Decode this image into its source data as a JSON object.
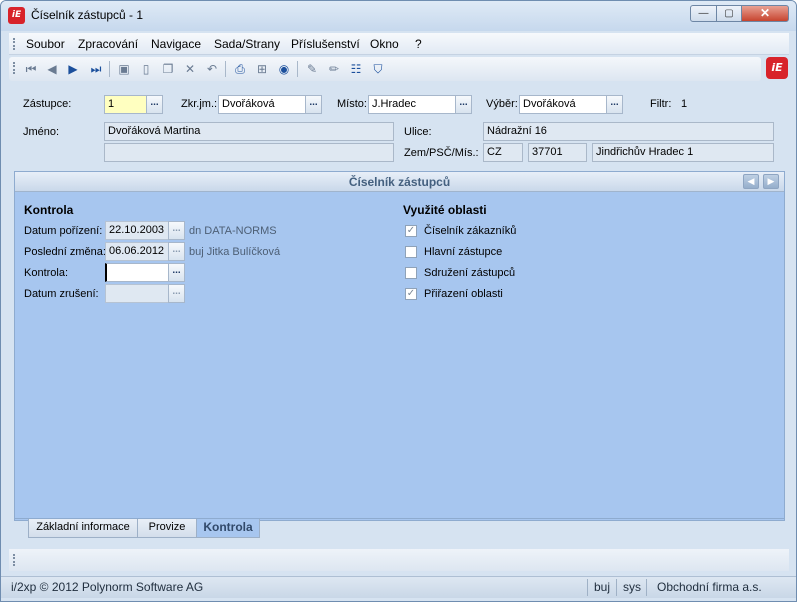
{
  "window": {
    "title": "Číselník zástupců - 1",
    "logo_text": "iE",
    "controls": {
      "minimize": "—",
      "maximize": "▢",
      "close": "✕"
    }
  },
  "menu": [
    "Soubor",
    "Zpracování",
    "Navigace",
    "Sada/Strany",
    "Příslušenství",
    "Okno",
    "?"
  ],
  "toolbar": {
    "icons": [
      "first-record-icon",
      "previous-record-icon",
      "next-record-icon",
      "last-record-icon",
      "save-icon",
      "new-document-icon",
      "copy-icon",
      "delete-icon",
      "undo-icon",
      "print-icon",
      "tree-icon",
      "refresh-icon",
      "edit-icon",
      "pencil-icon",
      "properties-icon",
      "filter-icon"
    ],
    "brand_logo": "iE"
  },
  "header": {
    "zastupce_label": "Zástupce:",
    "zastupce_value": "1",
    "zkrjm_label": "Zkr.jm.:",
    "zkrjm_value": "Dvořáková",
    "misto_label": "Místo:",
    "misto_value": "J.Hradec",
    "vyber_label": "Výběr:",
    "vyber_value": "Dvořáková",
    "filtr_label": "Filtr:",
    "filtr_value": "1",
    "jmeno_label": "Jméno:",
    "jmeno_value": "Dvořáková Martina",
    "jmeno2_value": "",
    "ulice_label": "Ulice:",
    "ulice_value": "Nádražní 16",
    "zem_label": "Zem/PSČ/Mís.:",
    "zem_value": "CZ",
    "psc_value": "37701",
    "mesto_value": "Jindřichův Hradec 1",
    "dots": "..."
  },
  "panel": {
    "title": "Číselník zástupců",
    "nav_prev": "◀",
    "nav_next": "▶",
    "kontrola_section": "Kontrola",
    "datum_porizeni_label": "Datum pořízení:",
    "datum_porizeni_value": "22.10.2003",
    "datum_porizeni_suffix": "dn  DATA-NORMS",
    "posledni_zmena_label": "Poslední změna:",
    "posledni_zmena_value": "06.06.2012",
    "posledni_zmena_suffix": "buj  Jitka Bulíčková",
    "kontrola_label": "Kontrola:",
    "kontrola_value": "",
    "datum_zruseni_label": "Datum zrušení:",
    "datum_zruseni_value": "",
    "oblasti_section": "Využité oblasti",
    "checkboxes": [
      {
        "label": "Číselník zákazníků",
        "checked": true
      },
      {
        "label": "Hlavní zástupce",
        "checked": false
      },
      {
        "label": "Sdružení zástupců",
        "checked": false
      },
      {
        "label": "Přiřazení oblasti",
        "checked": true
      }
    ]
  },
  "tabs": [
    "Základní informace",
    "Provize",
    "Kontrola"
  ],
  "active_tab": "Kontrola",
  "status": {
    "copyright": "i/2xp © 2012 Polynorm Software AG",
    "user": "buj",
    "db": "sys",
    "company": "Obchodní firma a.s."
  }
}
